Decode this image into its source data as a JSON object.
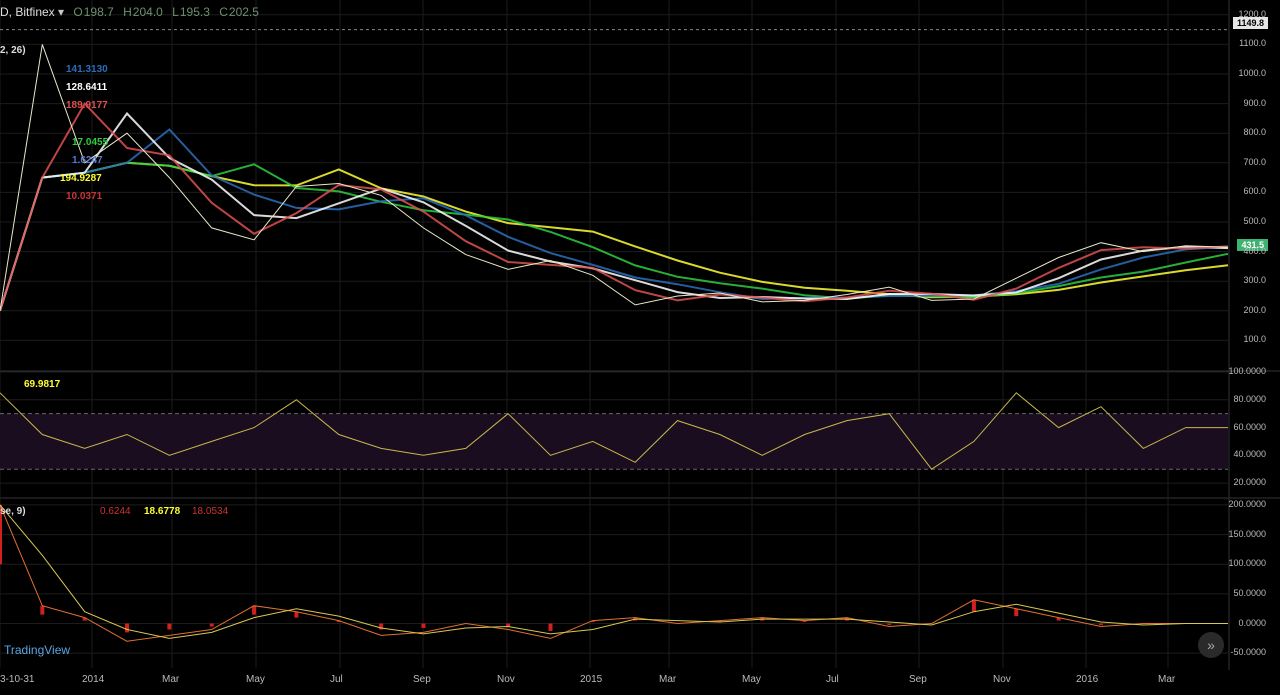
{
  "header": {
    "symbol": "D, Bitfinex",
    "open_label": "O",
    "open": "198.7",
    "high_label": "H",
    "high": "204.0",
    "low_label": "L",
    "low": "195.3",
    "close_label": "C",
    "close": "202.5"
  },
  "indicators": {
    "ma_values": [
      "141.3130",
      "128.6411",
      "189.9177",
      "17.0455",
      "1.6247",
      "194.9287",
      "10.0371"
    ],
    "ma_colors": [
      "#2a6ebb",
      "#ffffff",
      "#e05050",
      "#2ecc40",
      "#5a78d0",
      "#ffff33",
      "#cc3333"
    ],
    "panel_label": "2, 26)",
    "rsi_value": "69.9817",
    "macd_label": "se, 9)",
    "macd_value1": "0.6244",
    "macd_value2": "18.6778",
    "macd_value3": "18.0534"
  },
  "price_axis": {
    "ticks": [
      "1200.0",
      "1100.0",
      "1000.0",
      "900.0",
      "800.0",
      "700.0",
      "600.0",
      "500.0",
      "400.0",
      "300.0",
      "200.0",
      "100.0"
    ],
    "last_high_badge": "1149.8",
    "last_price_badge": "431.5"
  },
  "rsi_axis": {
    "ticks": [
      "100.0000",
      "80.0000",
      "60.0000",
      "40.0000",
      "20.0000"
    ]
  },
  "macd_axis": {
    "ticks": [
      "200.0000",
      "150.0000",
      "100.0000",
      "50.0000",
      "0.0000",
      "-50.0000"
    ]
  },
  "time_axis": {
    "ticks": [
      "3-10-31",
      "2014",
      "Mar",
      "May",
      "Jul",
      "Sep",
      "Nov",
      "2015",
      "Mar",
      "May",
      "Jul",
      "Sep",
      "Nov",
      "2016",
      "Mar"
    ]
  },
  "logo": "TradingView",
  "chart_data": {
    "type": "line",
    "title": "",
    "price_series": {
      "name": "",
      "x": [
        "2013-10-31",
        "2013-11-30",
        "2013-12-31",
        "2014-01-31",
        "2014-02-28",
        "2014-03-31",
        "2014-04-30",
        "2014-05-31",
        "2014-06-30",
        "2014-07-31",
        "2014-08-31",
        "2014-09-30",
        "2014-10-31",
        "2014-11-30",
        "2014-12-31",
        "2015-01-31",
        "2015-02-28",
        "2015-03-31",
        "2015-04-30",
        "2015-05-31",
        "2015-06-30",
        "2015-07-31",
        "2015-08-31",
        "2015-09-30",
        "2015-10-31",
        "2015-11-30",
        "2015-12-31",
        "2016-01-31",
        "2016-02-29",
        "2016-03-31"
      ],
      "y": [
        200,
        1100,
        700,
        800,
        650,
        480,
        440,
        620,
        630,
        590,
        480,
        390,
        340,
        370,
        320,
        220,
        250,
        260,
        230,
        235,
        255,
        280,
        235,
        240,
        310,
        380,
        430,
        400,
        420,
        415
      ]
    },
    "ylim": [
      0,
      1250
    ],
    "rsi": {
      "ylim": [
        10,
        100
      ],
      "upper_band": 70,
      "lower_band": 30,
      "y": [
        85,
        55,
        45,
        55,
        40,
        50,
        60,
        80,
        55,
        45,
        40,
        45,
        70,
        40,
        50,
        35,
        65,
        55,
        40,
        55,
        65,
        70,
        30,
        50,
        85,
        60,
        75,
        45,
        60,
        60
      ]
    },
    "macd": {
      "ylim": [
        -75,
        210
      ],
      "y": [
        200,
        30,
        10,
        -30,
        -20,
        -10,
        30,
        20,
        5,
        -20,
        -15,
        0,
        -10,
        -25,
        5,
        10,
        0,
        5,
        10,
        5,
        10,
        -5,
        0,
        40,
        25,
        10,
        -5,
        0,
        0,
        0
      ]
    },
    "grid": true
  }
}
